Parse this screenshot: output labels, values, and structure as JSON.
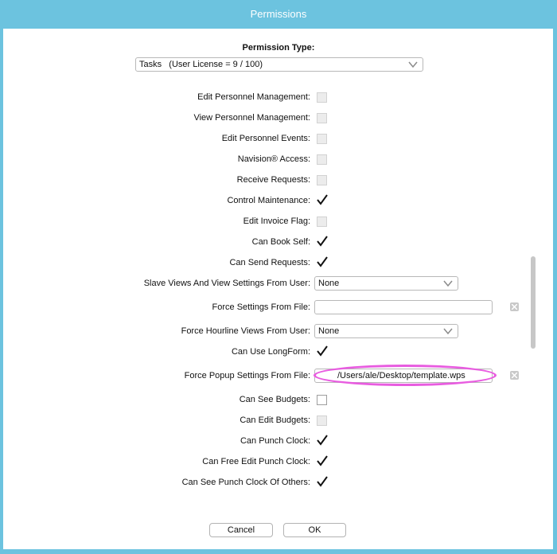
{
  "window": {
    "title": "Permissions"
  },
  "permission_type": {
    "label": "Permission Type:",
    "selected": "Tasks   (User License = 9 / 100)"
  },
  "permissions": {
    "edit_personnel_management": {
      "label": "Edit Personnel Management:",
      "checked": false
    },
    "view_personnel_management": {
      "label": "View Personnel Management:",
      "checked": false
    },
    "edit_personnel_events": {
      "label": "Edit Personnel Events:",
      "checked": false
    },
    "navision_access": {
      "label": "Navision® Access:",
      "checked": false
    },
    "receive_requests": {
      "label": "Receive Requests:",
      "checked": false
    },
    "control_maintenance": {
      "label": "Control Maintenance:",
      "checked": true
    },
    "edit_invoice_flag": {
      "label": "Edit Invoice Flag:",
      "checked": false
    },
    "can_book_self": {
      "label": "Can Book Self:",
      "checked": true
    },
    "can_send_requests": {
      "label": "Can Send Requests:",
      "checked": true
    },
    "slave_views": {
      "label": "Slave Views And View Settings From User:",
      "value": "None"
    },
    "force_settings_file": {
      "label": "Force Settings From File:",
      "value": ""
    },
    "force_hourline_views": {
      "label": "Force Hourline Views From User:",
      "value": "None"
    },
    "can_use_longform": {
      "label": "Can Use LongForm:",
      "checked": true
    },
    "force_popup_settings": {
      "label": "Force Popup Settings From File:",
      "value": "/Users/ale/Desktop/template.wps"
    },
    "can_see_budgets": {
      "label": "Can See Budgets:",
      "checked": false
    },
    "can_edit_budgets": {
      "label": "Can Edit Budgets:",
      "checked": false
    },
    "can_punch_clock": {
      "label": "Can Punch Clock:",
      "checked": true
    },
    "can_free_edit_punch_clock": {
      "label": "Can Free Edit Punch Clock:",
      "checked": true
    },
    "can_see_punch_clock_others": {
      "label": "Can See Punch Clock Of Others:",
      "checked": true
    }
  },
  "buttons": {
    "cancel": "Cancel",
    "ok": "OK"
  },
  "colors": {
    "titlebar": "#6cc3df",
    "highlight": "#e85ce0"
  },
  "icons": {
    "check": "checkmark-icon",
    "chevron": "chevron-down-icon",
    "clear": "clear-x-icon"
  }
}
